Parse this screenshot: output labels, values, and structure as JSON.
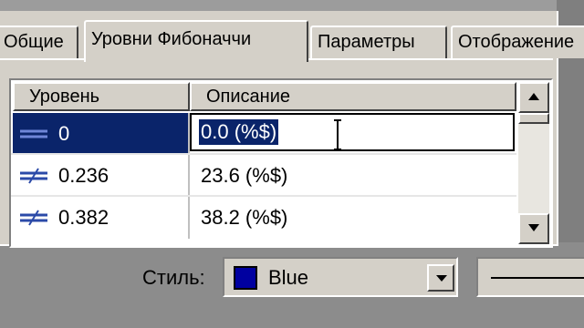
{
  "tabs": [
    {
      "label": "Общие",
      "active": false
    },
    {
      "label": "Уровни Фибоначчи",
      "active": true
    },
    {
      "label": "Параметры",
      "active": false
    },
    {
      "label": "Отображение",
      "active": false
    }
  ],
  "table": {
    "columns": [
      "Уровень",
      "Описание"
    ],
    "rows": [
      {
        "level": "0",
        "description": "0.0 (%$)",
        "selected": true,
        "editing": true
      },
      {
        "level": "0.236",
        "description": "23.6 (%$)",
        "selected": false
      },
      {
        "level": "0.382",
        "description": "38.2 (%$)",
        "selected": false
      }
    ]
  },
  "style": {
    "label": "Стиль:",
    "color_name": "Blue",
    "color_value": "#0000a0"
  },
  "colors": {
    "selection": "#0a246a",
    "dialog_face": "#d4d0c8",
    "level_icon": "#2b4aa8"
  },
  "icons": {
    "level_icon": "fibo-line-icon",
    "scroll_up": "arrow-up-icon",
    "scroll_down": "arrow-down-icon",
    "combo": "arrow-down-icon",
    "cursor": "text-cursor-icon"
  }
}
